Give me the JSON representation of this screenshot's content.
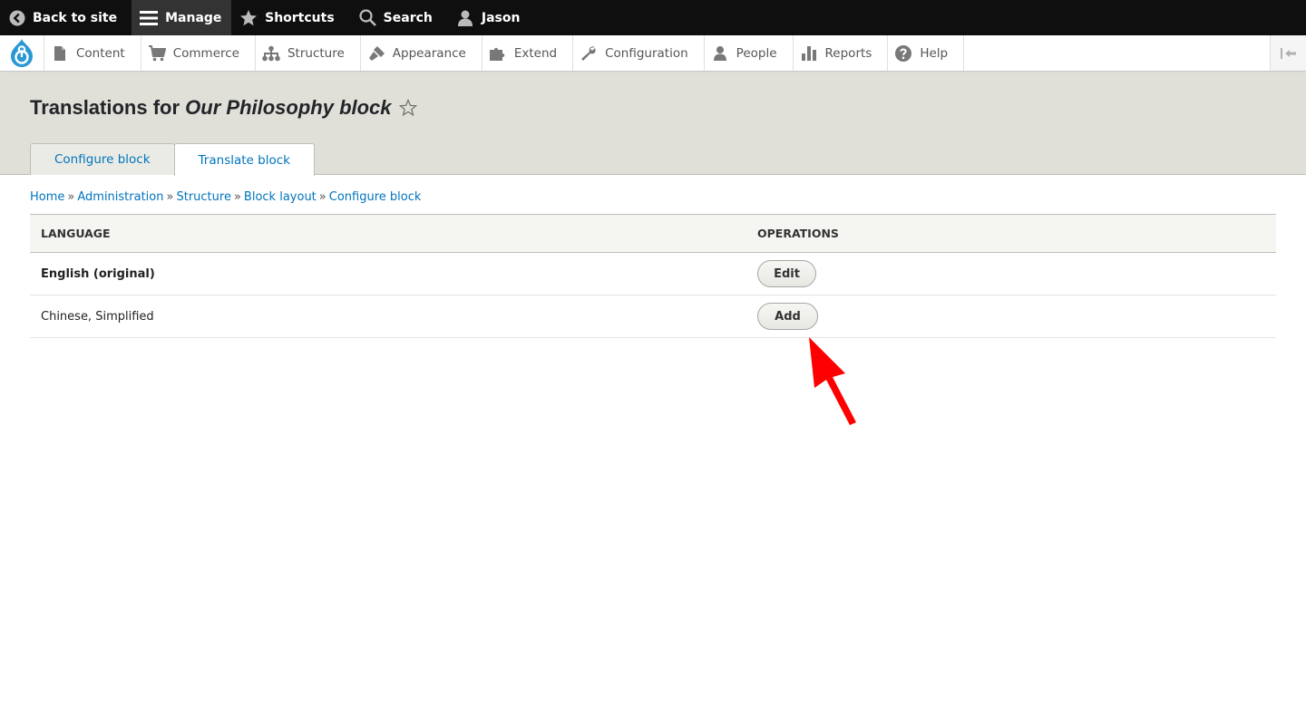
{
  "toolbar": {
    "back_label": "Back to site",
    "manage_label": "Manage",
    "shortcuts_label": "Shortcuts",
    "search_label": "Search",
    "user_label": "Jason"
  },
  "admin_menu": {
    "items": [
      {
        "label": "Content",
        "icon": "file-icon"
      },
      {
        "label": "Commerce",
        "icon": "cart-icon"
      },
      {
        "label": "Structure",
        "icon": "sitemap-icon"
      },
      {
        "label": "Appearance",
        "icon": "paintbrush-icon"
      },
      {
        "label": "Extend",
        "icon": "puzzle-icon"
      },
      {
        "label": "Configuration",
        "icon": "wrench-icon"
      },
      {
        "label": "People",
        "icon": "person-icon"
      },
      {
        "label": "Reports",
        "icon": "bar-chart-icon"
      },
      {
        "label": "Help",
        "icon": "help-icon"
      }
    ]
  },
  "page": {
    "title_prefix": "Translations for",
    "title_entity": "Our Philosophy block"
  },
  "tabs": [
    {
      "label": "Configure block",
      "active": false
    },
    {
      "label": "Translate block",
      "active": true
    }
  ],
  "breadcrumb": [
    "Home",
    "Administration",
    "Structure",
    "Block layout",
    "Configure block"
  ],
  "breadcrumb_separator": "»",
  "table": {
    "headers": {
      "language": "Language",
      "operations": "Operations"
    },
    "rows": [
      {
        "language": "English (original)",
        "operation": "Edit"
      },
      {
        "language": "Chinese, Simplified",
        "operation": "Add"
      }
    ]
  },
  "colors": {
    "toolbar_bg": "#0f0f0f",
    "header_bg": "#e0e0d8",
    "link": "#0074bd",
    "annotation_arrow": "#ff0000"
  }
}
